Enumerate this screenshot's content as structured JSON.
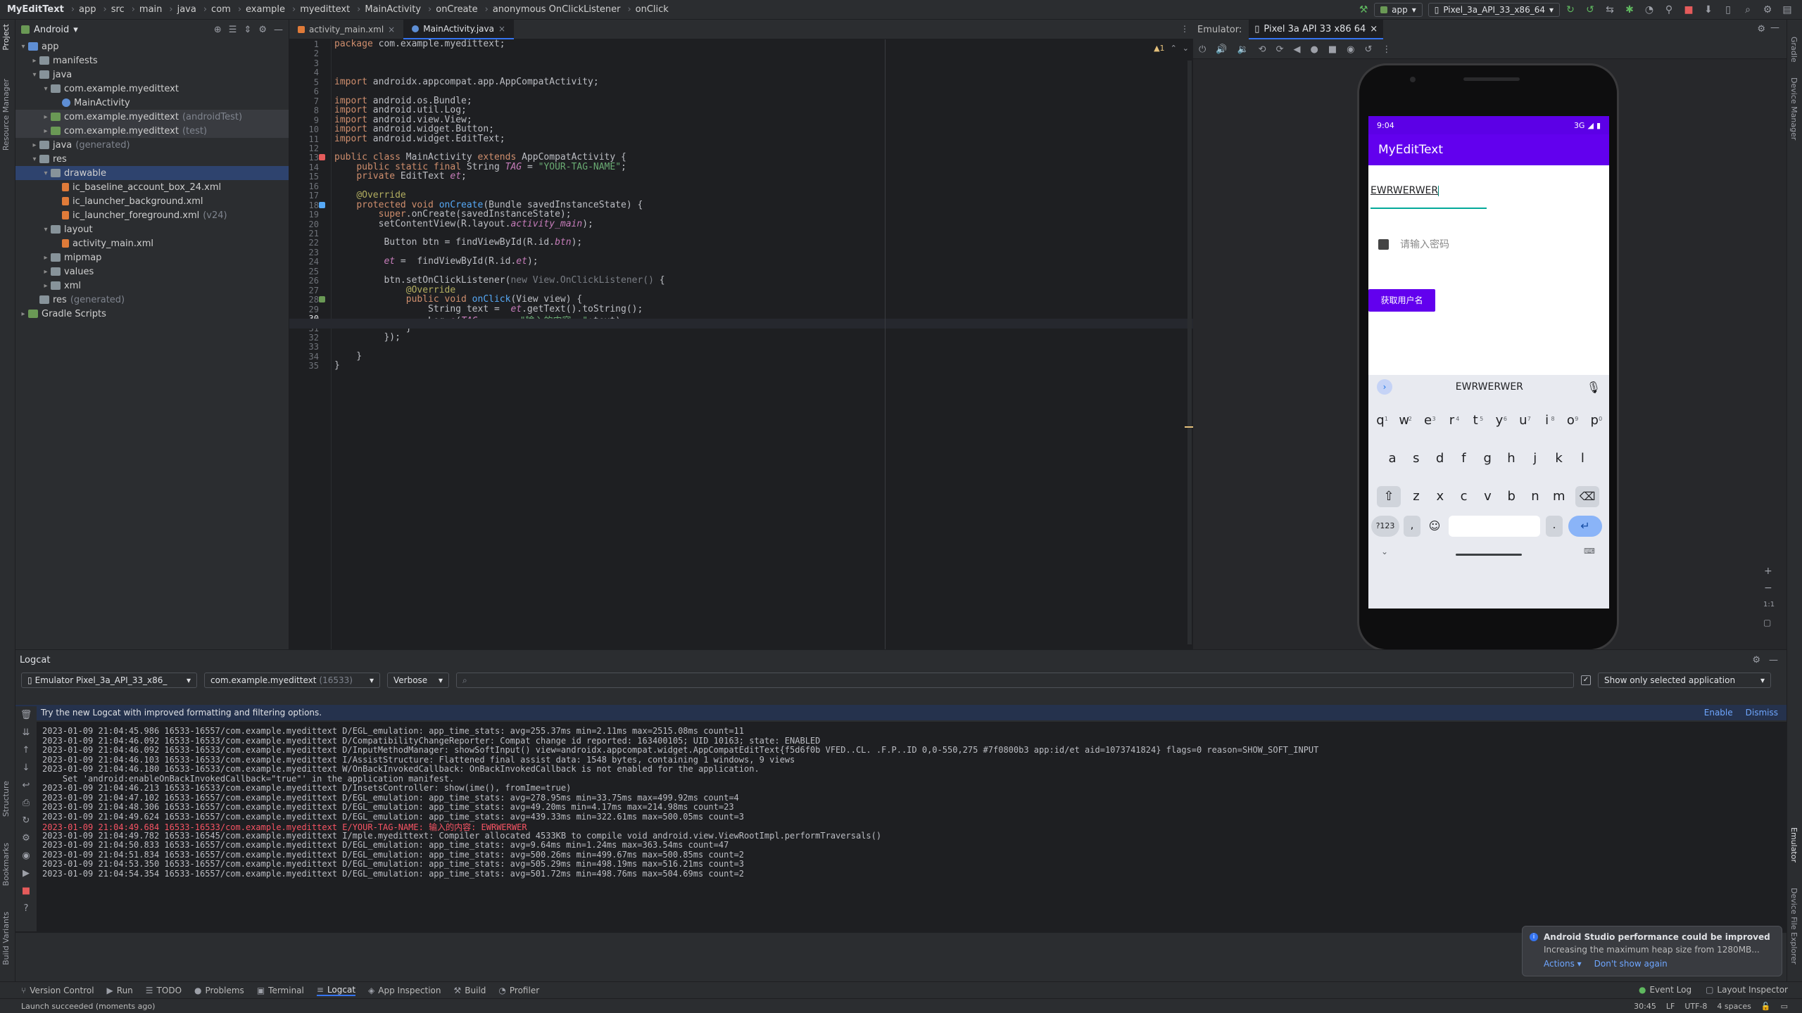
{
  "navbar": {
    "crumbs": [
      "MyEditText",
      "app",
      "src",
      "main",
      "java",
      "com",
      "example",
      "myedittext",
      "MainActivity",
      "onCreate",
      "anonymous OnClickListener",
      "onClick"
    ],
    "run_config": "app",
    "device": "Pixel_3a_API_33_x86_64"
  },
  "left_stripe": {
    "project": "Project",
    "resource": "Resource Manager",
    "structure": "Structure",
    "bookmarks": "Bookmarks",
    "build_variants": "Build Variants"
  },
  "right_stripe": {
    "gradle": "Gradle",
    "device_manager": "Device Manager",
    "emulator": "Emulator",
    "device_file_explorer": "Device File Explorer"
  },
  "project": {
    "view_mode": "Android",
    "tree": [
      {
        "label": "app",
        "indent": 0,
        "arrow": "▾",
        "type": "fold"
      },
      {
        "label": "manifests",
        "indent": 1,
        "arrow": "▸",
        "type": "fold"
      },
      {
        "label": "java",
        "indent": 1,
        "arrow": "▾",
        "type": "fold"
      },
      {
        "label": "com.example.myedittext",
        "indent": 2,
        "arrow": "▾",
        "type": "fold"
      },
      {
        "label": "MainActivity",
        "indent": 3,
        "arrow": "",
        "type": "class"
      },
      {
        "label": "com.example.myedittext",
        "suffix": "(androidTest)",
        "indent": 2,
        "arrow": "▸",
        "type": "fold",
        "hl": true
      },
      {
        "label": "com.example.myedittext",
        "suffix": "(test)",
        "indent": 2,
        "arrow": "▸",
        "type": "fold",
        "hl": true
      },
      {
        "label": "java",
        "suffix": "(generated)",
        "indent": 1,
        "arrow": "▸",
        "type": "fold"
      },
      {
        "label": "res",
        "indent": 1,
        "arrow": "▾",
        "type": "fold"
      },
      {
        "label": "drawable",
        "indent": 2,
        "arrow": "▾",
        "type": "fold",
        "sel": true
      },
      {
        "label": "ic_baseline_account_box_24.xml",
        "indent": 3,
        "arrow": "",
        "type": "xml"
      },
      {
        "label": "ic_launcher_background.xml",
        "indent": 3,
        "arrow": "",
        "type": "xml"
      },
      {
        "label": "ic_launcher_foreground.xml",
        "suffix": "(v24)",
        "indent": 3,
        "arrow": "",
        "type": "xml"
      },
      {
        "label": "layout",
        "indent": 2,
        "arrow": "▾",
        "type": "fold"
      },
      {
        "label": "activity_main.xml",
        "indent": 3,
        "arrow": "",
        "type": "xml"
      },
      {
        "label": "mipmap",
        "indent": 2,
        "arrow": "▸",
        "type": "fold"
      },
      {
        "label": "values",
        "indent": 2,
        "arrow": "▸",
        "type": "fold"
      },
      {
        "label": "xml",
        "indent": 2,
        "arrow": "▸",
        "type": "fold"
      },
      {
        "label": "res",
        "suffix": "(generated)",
        "indent": 1,
        "arrow": "",
        "type": "fold"
      },
      {
        "label": "Gradle Scripts",
        "indent": 0,
        "arrow": "▸",
        "type": "gradle"
      }
    ]
  },
  "editor": {
    "tabs": [
      {
        "label": "activity_main.xml",
        "active": false
      },
      {
        "label": "MainActivity.java",
        "active": true
      }
    ],
    "warnings": "▲1",
    "lines": [
      "<span class=\"kw\">package</span> com.example.myedittext;",
      "",
      "",
      "",
      "<span class=\"kw\">import</span> androidx.appcompat.app.AppCompatActivity;",
      "",
      "<span class=\"kw\">import</span> android.os.Bundle;",
      "<span class=\"kw\">import</span> android.util.Log;",
      "<span class=\"kw\">import</span> android.view.View;",
      "<span class=\"kw\">import</span> android.widget.Button;",
      "<span class=\"kw\">import</span> android.widget.EditText;",
      "",
      "<span class=\"kw\">public class</span> MainActivity <span class=\"kw\">extends</span> AppCompatActivity {",
      "    <span class=\"kw\">public static final</span> String <span class=\"it\">TAG</span> = <span class=\"str\">\"YOUR-TAG-NAME\"</span>;",
      "    <span class=\"kw\">private</span> EditText <span class=\"it\">et</span>;",
      "",
      "    <span class=\"ann\">@Override</span>",
      "    <span class=\"kw\">protected void</span> <span class=\"fn\">onCreate</span>(Bundle savedInstanceState) {",
      "        <span class=\"kw\">super</span>.onCreate(savedInstanceState);",
      "        setContentView(R.layout.<span class=\"it\">activity_main</span>);",
      "",
      "         Button btn = findViewById(R.id.<span class=\"it\">btn</span>);",
      "",
      "         <span class=\"it\">et</span> =  findViewById(R.id.<span class=\"it\">et</span>);",
      "",
      "         btn.setOnClickListener(<span class=\"gr\">new View.OnClickListener()</span> {",
      "             <span class=\"ann\">@Override</span>",
      "             <span class=\"kw\">public void</span> <span class=\"fn\">onClick</span>(View view) {",
      "                 String text =  <span class=\"it\">et</span>.getText().toString();",
      "                 Log.<span class=\"it\">e</span>(<span class=\"it\">TAG</span>,  <span class=\"hint\">msg:</span> <span class=\"str\">\"输入的内容: \"</span>+text);",
      "             }",
      "         });",
      "",
      "    }",
      "}"
    ]
  },
  "emulator": {
    "label": "Emulator:",
    "device_tab": "Pixel 3a API 33 x86 64",
    "phone": {
      "time": "9:04",
      "network": "3G",
      "app_title": "MyEditText",
      "input_value": "EWRWERWER",
      "password_placeholder": "请输入密码",
      "button_label": "获取用户名",
      "suggestion": "EWRWERWER",
      "keys_row1": [
        "q",
        "w",
        "e",
        "r",
        "t",
        "y",
        "u",
        "i",
        "o",
        "p"
      ],
      "nums_row1": [
        "1",
        "2",
        "3",
        "4",
        "5",
        "6",
        "7",
        "8",
        "9",
        "0"
      ],
      "keys_row2": [
        "a",
        "s",
        "d",
        "f",
        "g",
        "h",
        "j",
        "k",
        "l"
      ],
      "keys_row3": [
        "z",
        "x",
        "c",
        "v",
        "b",
        "n",
        "m"
      ],
      "sym_key": "?123",
      "comma_key": ",",
      "period_key": "."
    },
    "zoom_label": "1:1"
  },
  "logcat": {
    "title": "Logcat",
    "device_filter": "Emulator Pixel_3a_API_33_x86_",
    "package_filter": "com.example.myedittext",
    "pid": "(16533)",
    "level": "Verbose",
    "filter_mode": "Show only selected application",
    "banner_text": "Try the new Logcat with improved formatting and filtering options.",
    "banner_enable": "Enable",
    "banner_dismiss": "Dismiss",
    "lines": [
      {
        "text": "2023-01-09 21:04:45.986 16533-16557/com.example.myedittext D/EGL_emulation: app_time_stats: avg=255.37ms min=2.11ms max=2515.08ms count=11",
        "err": false
      },
      {
        "text": "2023-01-09 21:04:46.092 16533-16533/com.example.myedittext D/CompatibilityChangeReporter: Compat change id reported: 163400105; UID 10163; state: ENABLED",
        "err": false
      },
      {
        "text": "2023-01-09 21:04:46.092 16533-16533/com.example.myedittext D/InputMethodManager: showSoftInput() view=androidx.appcompat.widget.AppCompatEditText{f5d6f0b VFED..CL. .F.P..ID 0,0-550,275 #7f0800b3 app:id/et aid=1073741824} flags=0 reason=SHOW_SOFT_INPUT",
        "err": false
      },
      {
        "text": "2023-01-09 21:04:46.103 16533-16533/com.example.myedittext I/AssistStructure: Flattened final assist data: 1548 bytes, containing 1 windows, 9 views",
        "err": false
      },
      {
        "text": "2023-01-09 21:04:46.180 16533-16533/com.example.myedittext W/OnBackInvokedCallback: OnBackInvokedCallback is not enabled for the application.",
        "err": false
      },
      {
        "text": "    Set 'android:enableOnBackInvokedCallback=\"true\"' in the application manifest.",
        "err": false
      },
      {
        "text": "2023-01-09 21:04:46.213 16533-16533/com.example.myedittext D/InsetsController: show(ime(), fromIme=true)",
        "err": false
      },
      {
        "text": "2023-01-09 21:04:47.102 16533-16557/com.example.myedittext D/EGL_emulation: app_time_stats: avg=278.95ms min=33.75ms max=499.92ms count=4",
        "err": false
      },
      {
        "text": "2023-01-09 21:04:48.306 16533-16557/com.example.myedittext D/EGL_emulation: app_time_stats: avg=49.20ms min=4.17ms max=214.98ms count=23",
        "err": false
      },
      {
        "text": "2023-01-09 21:04:49.624 16533-16557/com.example.myedittext D/EGL_emulation: app_time_stats: avg=439.33ms min=322.61ms max=500.05ms count=3",
        "err": false
      },
      {
        "text": "2023-01-09 21:04:49.684 16533-16533/com.example.myedittext E/YOUR-TAG-NAME: 输入的内容: EWRWERWER",
        "err": true
      },
      {
        "text": "2023-01-09 21:04:49.782 16533-16545/com.example.myedittext I/mple.myedittext: Compiler allocated 4533KB to compile void android.view.ViewRootImpl.performTraversals()",
        "err": false
      },
      {
        "text": "2023-01-09 21:04:50.833 16533-16557/com.example.myedittext D/EGL_emulation: app_time_stats: avg=9.64ms min=1.24ms max=363.54ms count=47",
        "err": false
      },
      {
        "text": "2023-01-09 21:04:51.834 16533-16557/com.example.myedittext D/EGL_emulation: app_time_stats: avg=500.26ms min=499.67ms max=500.85ms count=2",
        "err": false
      },
      {
        "text": "2023-01-09 21:04:53.350 16533-16557/com.example.myedittext D/EGL_emulation: app_time_stats: avg=505.29ms min=498.19ms max=516.21ms count=3",
        "err": false
      },
      {
        "text": "2023-01-09 21:04:54.354 16533-16557/com.example.myedittext D/EGL_emulation: app_time_stats: avg=501.72ms min=498.76ms max=504.69ms count=2",
        "err": false
      }
    ]
  },
  "notification": {
    "title": "Android Studio performance could be improved",
    "body": "Increasing the maximum heap size from 1280MB...",
    "action1": "Actions ▾",
    "action2": "Don't show again"
  },
  "toolwindows": [
    {
      "label": "Version Control",
      "icon": "⑂"
    },
    {
      "label": "Run",
      "icon": "▶"
    },
    {
      "label": "TODO",
      "icon": "☰"
    },
    {
      "label": "Problems",
      "icon": "●"
    },
    {
      "label": "Terminal",
      "icon": "▣"
    },
    {
      "label": "Logcat",
      "icon": "≡",
      "active": true
    },
    {
      "label": "App Inspection",
      "icon": "◈"
    },
    {
      "label": "Build",
      "icon": "⚒"
    },
    {
      "label": "Profiler",
      "icon": "◔"
    }
  ],
  "toolwindows_right": [
    {
      "label": "Event Log",
      "icon": "●"
    },
    {
      "label": "Layout Inspector",
      "icon": "▢"
    }
  ],
  "statusbar": {
    "message": "Launch succeeded (moments ago)",
    "position": "30:45",
    "line_sep": "LF",
    "encoding": "UTF-8",
    "indent": "4 spaces"
  }
}
